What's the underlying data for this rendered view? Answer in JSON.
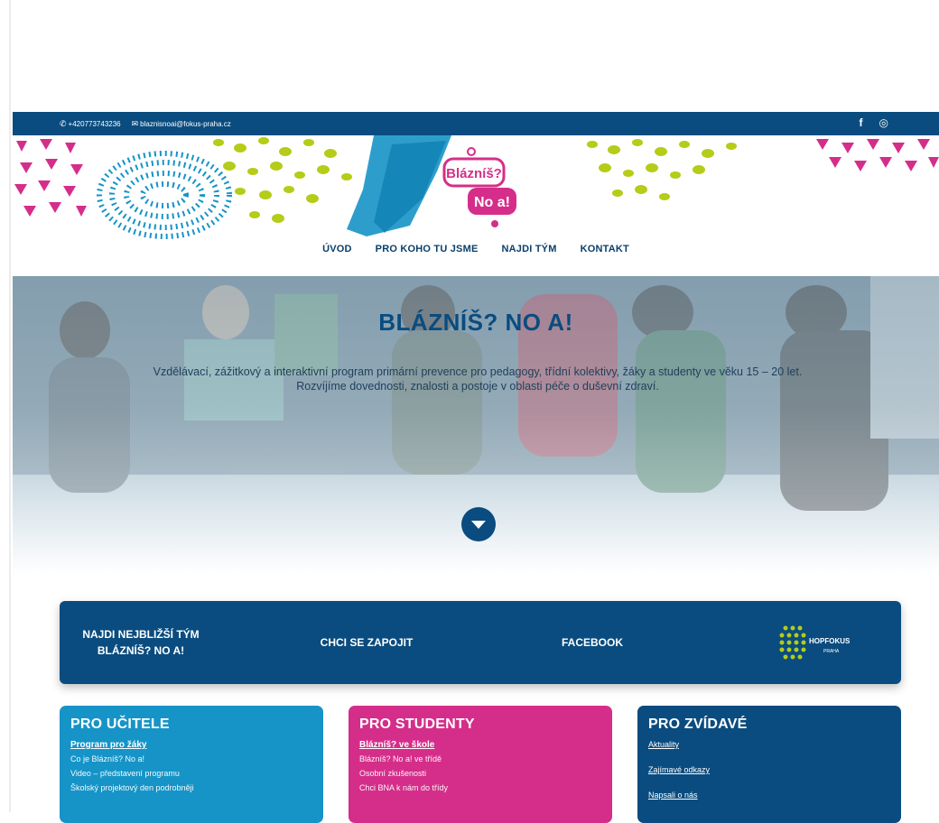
{
  "topbar": {
    "phone": "+420773743236",
    "email": "blaznisnoai@fokus-praha.cz",
    "social": [
      "f",
      "◎"
    ]
  },
  "logo": {
    "line1": "Blázníš?",
    "line2": "No a!"
  },
  "nav": [
    "ÚVOD",
    "PRO KOHO TU JSME",
    "NAJDI TÝM",
    "KONTAKT"
  ],
  "hero": {
    "title": "BLÁZNÍŠ? NO A!",
    "subtitle_line1": "Vzdělávací, zážitkový a interaktivní program primární prevence pro pedagogy, třídní kolektivy, žáky a studenty ve věku 15 – 20 let.",
    "subtitle_line2": "Rozvíjíme dovednosti, znalosti a postoje v oblasti péče o duševní zdraví."
  },
  "cta": {
    "find_team": "NAJDI NEJBLIŽŠÍ TÝM BLÁZNÍŠ? NO A!",
    "join": "CHCI SE ZAPOJIT",
    "facebook": "FACEBOOK",
    "partner": "HOPFOKUS",
    "partner_sub": "PRAHA"
  },
  "cards": {
    "teachers": {
      "title": "PRO UČITELE",
      "lead": "Program pro žáky",
      "items": [
        "Co je Blázníš? No a!",
        "Video – představení programu",
        "Školský projektový den podrobněji"
      ]
    },
    "students": {
      "title": "PRO STUDENTY",
      "lead": "Blázníš? ve škole",
      "items": [
        "Blázníš? No a! ve třídě",
        "Osobní zkušenosti",
        "Chci BNA k nám do třídy"
      ]
    },
    "curious": {
      "title": "PRO ZVÍDAVÉ",
      "links": [
        "Aktuality",
        "Zajímavé odkazy",
        "Napsali o nás"
      ]
    }
  },
  "colors": {
    "navy": "#0a4c7f",
    "blue": "#1694c7",
    "pink": "#d42e8a",
    "lime": "#b5cc18"
  }
}
